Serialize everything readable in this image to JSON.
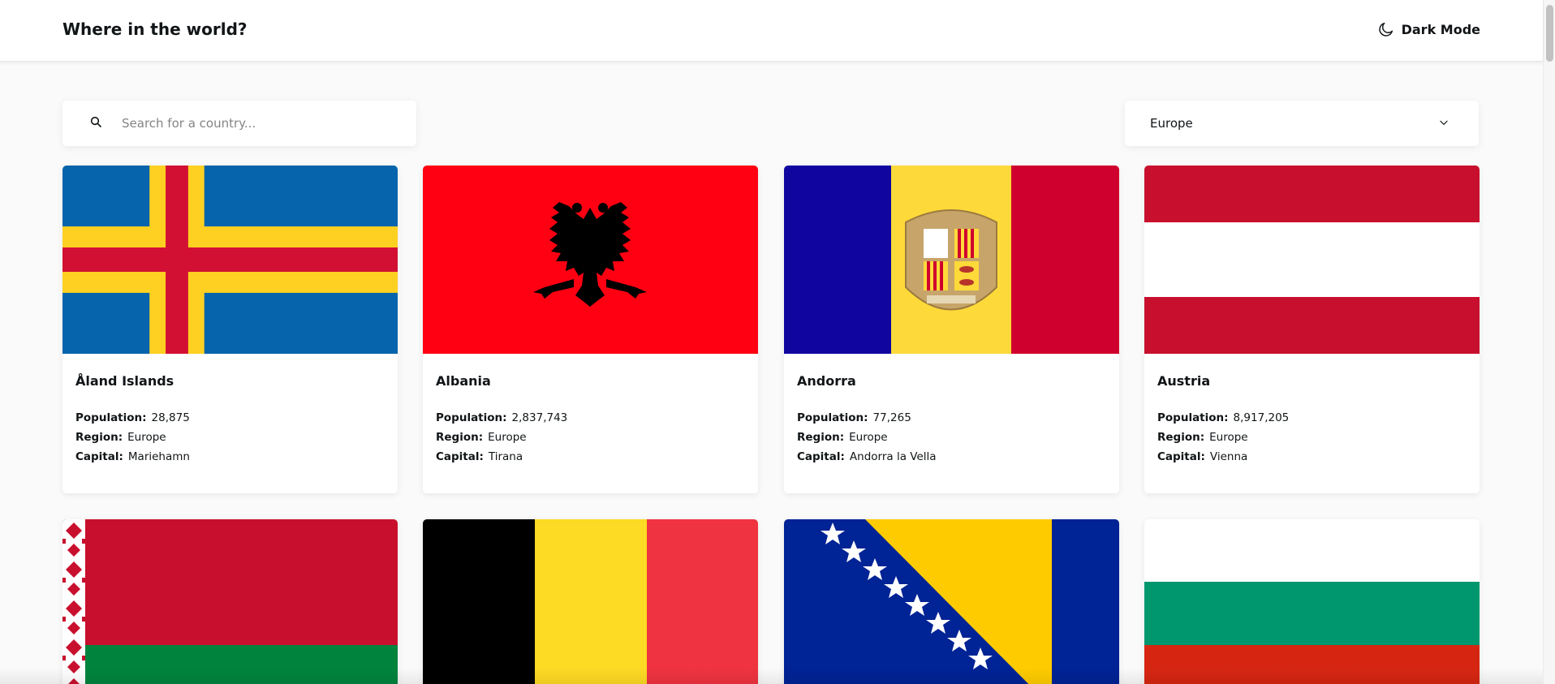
{
  "header": {
    "title": "Where in the world?",
    "dark_mode_label": "Dark Mode",
    "moon_icon": "moon-icon"
  },
  "search": {
    "placeholder": "Search for a country...",
    "value": "",
    "icon": "search-icon"
  },
  "filter": {
    "selected": "Europe",
    "icon": "chevron-down-icon"
  },
  "labels": {
    "population": "Population:",
    "region": "Region:",
    "capital": "Capital:"
  },
  "countries": [
    {
      "name": "Åland Islands",
      "population": "28,875",
      "region": "Europe",
      "capital": "Mariehamn",
      "flag": "aland-flag"
    },
    {
      "name": "Albania",
      "population": "2,837,743",
      "region": "Europe",
      "capital": "Tirana",
      "flag": "albania-flag"
    },
    {
      "name": "Andorra",
      "population": "77,265",
      "region": "Europe",
      "capital": "Andorra la Vella",
      "flag": "andorra-flag"
    },
    {
      "name": "Austria",
      "population": "8,917,205",
      "region": "Europe",
      "capital": "Vienna",
      "flag": "austria-flag"
    },
    {
      "flag": "belarus-flag"
    },
    {
      "flag": "belgium-flag"
    },
    {
      "flag": "bosnia-flag"
    },
    {
      "flag": "bulgaria-flag"
    }
  ],
  "colors": {
    "background": "#fafafa",
    "element": "#ffffff",
    "text": "#111517",
    "placeholder": "#848484"
  }
}
